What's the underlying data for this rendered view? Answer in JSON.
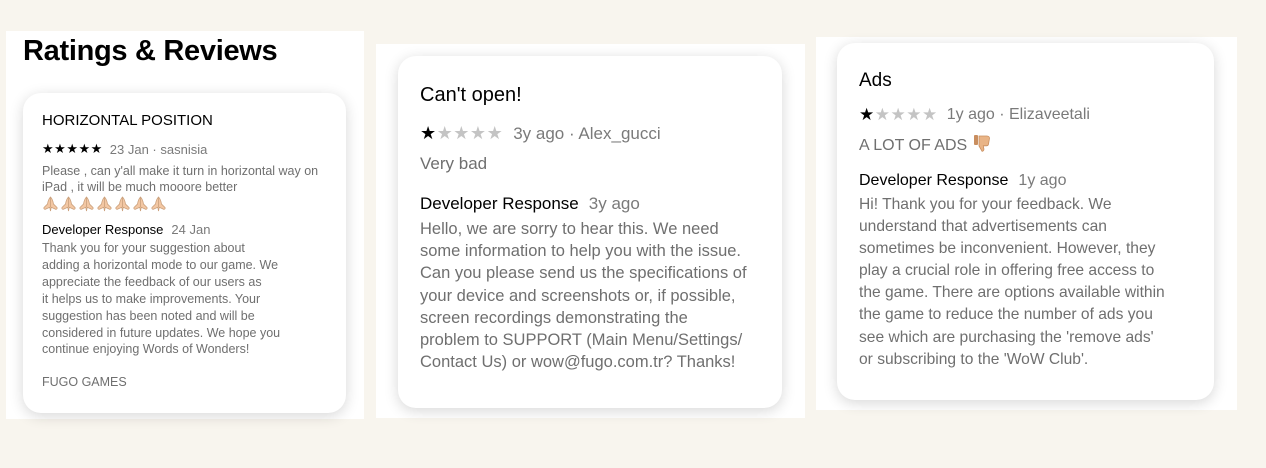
{
  "section_title": "Ratings & Reviews",
  "colors": {
    "background": "#f8f5ee",
    "star_filled": "#000000",
    "star_empty": "#c4c4c4",
    "secondary_text": "#7a7a7a"
  },
  "icons": {
    "star_filled": "star-filled-icon",
    "star_empty": "star-empty-icon",
    "praying_hands": "folded-hands-icon",
    "thumbs_down": "thumbs-down-icon"
  },
  "reviews": [
    {
      "title": "HORIZONTAL POSITION",
      "rating": 5,
      "date": "23 Jan",
      "author": "sasnisia",
      "meta": "23 Jan · sasnisia",
      "body": "Please , can y'all make it turn in horizontal way on iPad , it will be much mooore better",
      "emoji_count": 7,
      "developer_label": "Developer Response",
      "developer_date": "24 Jan",
      "developer_body": "Thank you for your suggestion about\nadding a horizontal mode to our game. We\nappreciate the feedback of our users as\nit helps us to make improvements. Your\nsuggestion has been noted and will be\nconsidered in future updates. We hope you\ncontinue enjoying Words of Wonders!",
      "developer_signature": "FUGO GAMES"
    },
    {
      "title": "Can't open!",
      "rating": 1,
      "date": "3y ago",
      "author": "Alex_gucci",
      "meta": "3y ago · Alex_gucci",
      "body": "Very bad",
      "developer_label": "Developer Response",
      "developer_date": "3y ago",
      "developer_body": "Hello, we are sorry to hear this. We need\nsome information to help you with the issue.\nCan you please send us the specifications of\nyour device and screenshots or, if possible,\nscreen recordings demonstrating the\nproblem to SUPPORT (Main Menu/Settings/\nContact Us) or wow@fugo.com.tr? Thanks!"
    },
    {
      "title": "Ads",
      "rating": 1,
      "date": "1y ago",
      "author": "Elizaveetali",
      "meta": "1y ago · Elizaveetali",
      "body": "A LOT OF ADS",
      "developer_label": "Developer Response",
      "developer_date": "1y ago",
      "developer_body": "Hi! Thank you for your feedback. We\nunderstand that advertisements can\nsometimes be inconvenient. However, they\nplay a crucial role in offering free access to\nthe game. There are options available within\nthe game to reduce the number of ads you\nsee which are purchasing the 'remove ads'\nor subscribing to the 'WoW Club'."
    }
  ]
}
